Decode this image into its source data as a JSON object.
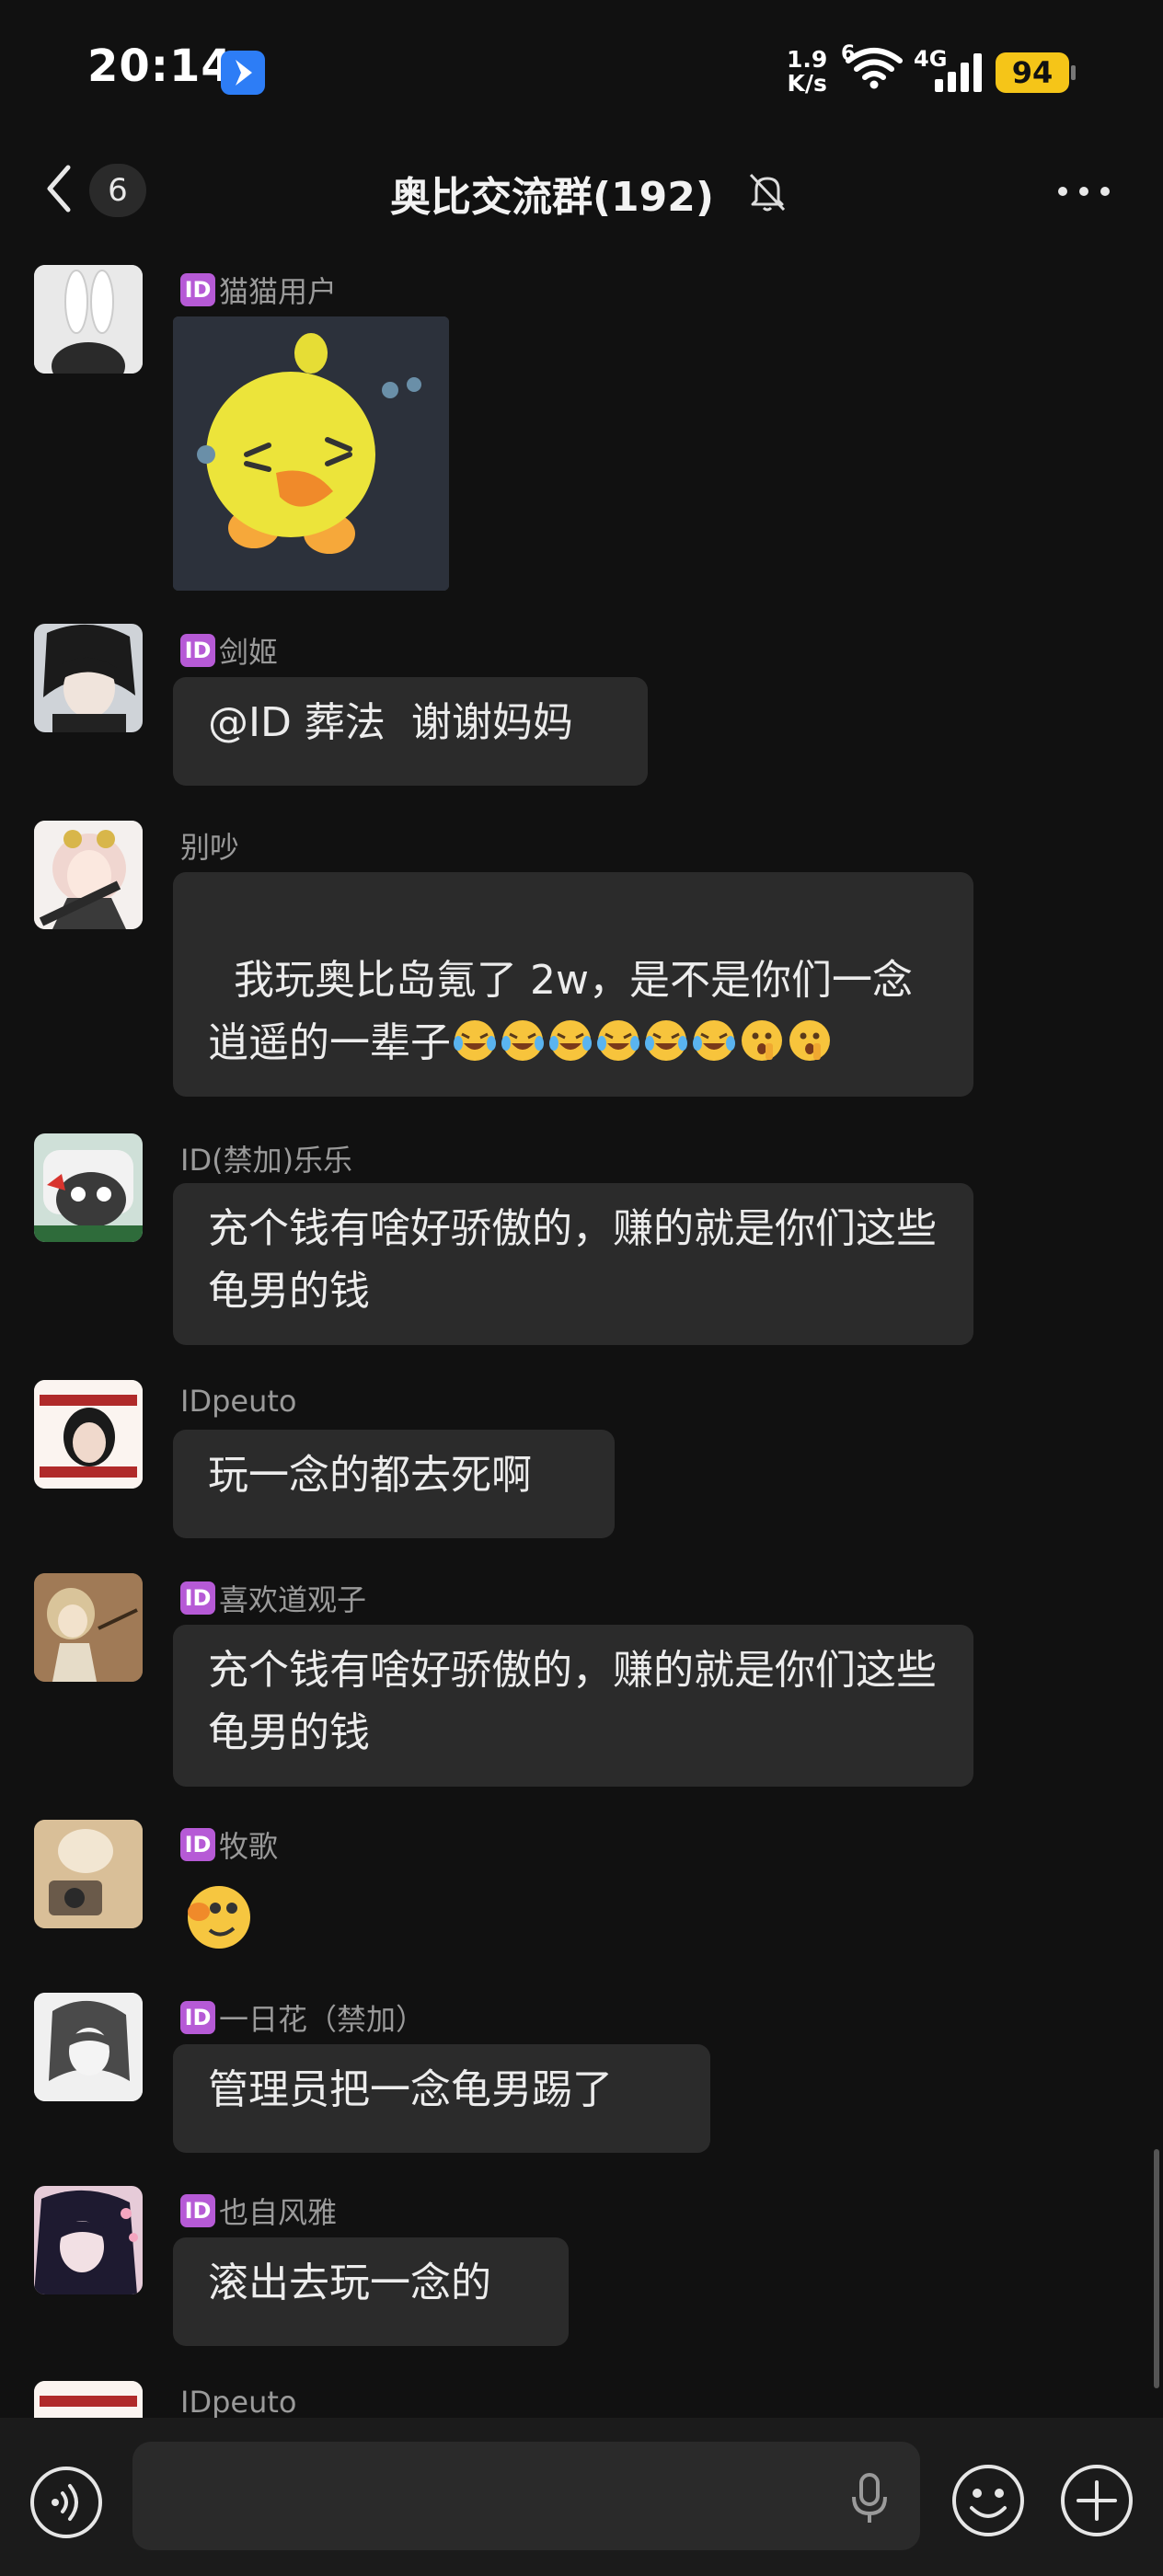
{
  "status_bar": {
    "time": "20:14",
    "net_speed_value": "1.9",
    "net_speed_unit": "K/s",
    "wifi_label": "6",
    "cell_label": "4G",
    "battery": "94",
    "battery_color": "#f5c518"
  },
  "nav": {
    "unread_count": "6",
    "title": "奥比交流群(192)"
  },
  "id_badge_text": "ID",
  "messages": [
    {
      "name": "猫猫用户",
      "badge": true,
      "kind": "sticker",
      "sticker": "yellow-duck-sticker"
    },
    {
      "name": "剑姬",
      "badge": true,
      "kind": "text",
      "text": "@ID 葬法  谢谢妈妈"
    },
    {
      "name": "别吵",
      "badge": false,
      "kind": "text",
      "text": "我玩奥比岛氪了 2w，是不是你们一念逍遥的一辈子",
      "emojis": [
        "laugh-cry-emoji",
        "laugh-cry-emoji",
        "laugh-cry-emoji",
        "laugh-cry-emoji",
        "laugh-cry-emoji",
        "laugh-cry-emoji",
        "shush-emoji",
        "shush-emoji"
      ]
    },
    {
      "name": "ID(禁加)乐乐",
      "badge": false,
      "kind": "text",
      "text": "充个钱有啥好骄傲的，赚的就是你们这些龟男的钱"
    },
    {
      "name": "IDpeuto",
      "badge": false,
      "kind": "text",
      "text": "玩一念的都去死啊"
    },
    {
      "name": "喜欢道观子",
      "badge": true,
      "kind": "text",
      "text": "充个钱有啥好骄傲的，赚的就是你们这些龟男的钱"
    },
    {
      "name": "牧歌",
      "badge": true,
      "kind": "sticker",
      "sticker": "small-duck-emoji"
    },
    {
      "name": "一日花（禁加）",
      "badge": true,
      "kind": "text",
      "text": "管理员把一念龟男踢了"
    },
    {
      "name": "也自风雅",
      "badge": true,
      "kind": "text",
      "text": "滚出去玩一念的"
    },
    {
      "name": "IDpeuto",
      "badge": false,
      "kind": "partial"
    }
  ],
  "input": {
    "placeholder": ""
  },
  "colors": {
    "background": "#111111",
    "bubble": "#2b2b2b",
    "id_badge": "#b65ad6",
    "name_text": "#9a9a9a"
  }
}
